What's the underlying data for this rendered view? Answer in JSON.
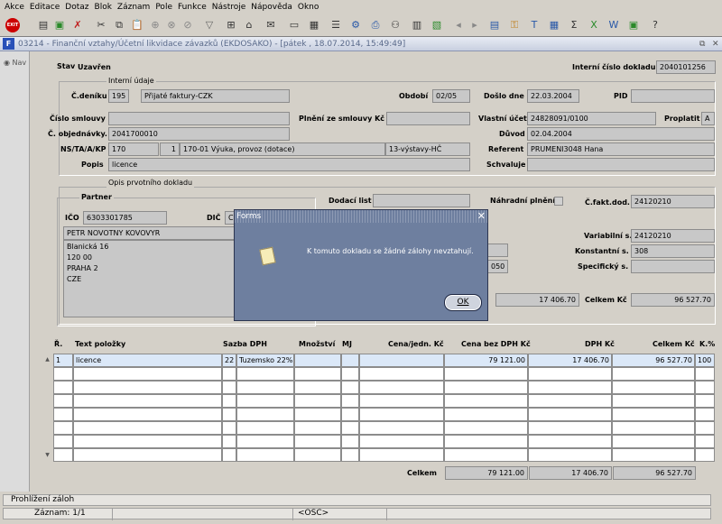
{
  "menu": [
    "Akce",
    "Editace",
    "Dotaz",
    "Blok",
    "Záznam",
    "Pole",
    "Funkce",
    "Nástroje",
    "Nápověda",
    "Okno"
  ],
  "window": {
    "title": "03214 - Finanční vztahy/Účetní likvidace závazků (EKDOSAKO) - [pátek , 18.07.2014, 15:49:49]",
    "nav_label": "Nav"
  },
  "form": {
    "stav_label": "Stav",
    "stav_value": "Uzavřen",
    "icd_label": "Interní číslo dokladu",
    "icd_value": "2040101256",
    "interni_udaje_title": "Interní údaje",
    "cdeniku_label": "Č.deníku",
    "cdeniku_value": "195",
    "cdeniku_text": "Přijaté faktury-CZK",
    "obdobi_label": "Období",
    "obdobi_value": "02/05",
    "doslo_label": "Došlo dne",
    "doslo_value": "22.03.2004",
    "pid_label": "PID",
    "pid_value": "",
    "smlouva_label": "Číslo smlouvy",
    "smlouva_value": "",
    "plneni_label": "Plnění ze smlouvy Kč",
    "plneni_value": "",
    "ucet_label": "Vlastní účet",
    "ucet_value": "24828091/0100",
    "proplatit_label": "Proplatit",
    "proplatit_value": "A",
    "objednavky_label": "Č. objednávky.",
    "objednavky_value": "2041700010",
    "duvod_label": "Důvod",
    "duvod_value": "02.04.2004",
    "ns_label": "NS/TA/A/KP",
    "ns_value": "170",
    "ta_value": "1",
    "a_value": "170-01 Výuka, provoz (dotace)",
    "kp_value": "13-výstavy-HČ",
    "referent_label": "Referent",
    "referent_value": "PRUMENI3048 Hana",
    "popis_label": "Popis",
    "popis_value": "licence",
    "schvaluje_label": "Schvaluje",
    "schvaluje_value": "",
    "opis_title": "Opis prvotního dokladu",
    "partner_title": "Partner",
    "ico_label": "IČO",
    "ico_value": "6303301785",
    "dic_label": "DIČ",
    "dic_value": "C",
    "partner_name": "PETR NOVOTNY KOVOVYR",
    "address": [
      "Blanická  16",
      "120 00",
      "PRAHA 2",
      "CZE"
    ],
    "dodaci_label": "Dodací list",
    "dodaci_value": "",
    "nahradni_label": "Náhradní plnění",
    "cfakt_label": "Č.fakt.dod.",
    "cfakt_value": "24120210",
    "var_label": "Variabilní s.",
    "var_value": "24120210",
    "konst_label": "Konstantní s.",
    "konst_value": "308",
    "spec_label": "Specifický s.",
    "spec_value": "",
    "hidden_val": "050",
    "dph_amount": "17 406.70",
    "celkem_label": "Celkem Kč",
    "celkem_value": "96 527.70"
  },
  "table": {
    "headers": [
      "Ř.",
      "Text položky",
      "Sazba DPH",
      "Množství",
      "MJ",
      "Cena/jedn. Kč",
      "Cena bez DPH Kč",
      "DPH Kč",
      "Celkem Kč",
      "K.%"
    ],
    "row": {
      "r": "1",
      "text": "licence",
      "sazba": "22",
      "typ": "Tuzemsko  22%",
      "mnozstvi": "",
      "mj": "",
      "cena": "",
      "bez_dph": "79 121.00",
      "dph": "17 406.70",
      "celkem": "96 527.70",
      "k": "100"
    },
    "totals_label": "Celkem",
    "total_bez_dph": "79 121.00",
    "total_dph": "17 406.70",
    "total_celkem": "96 527.70"
  },
  "dialog": {
    "title": "Forms",
    "message": "K tomuto dokladu se žádné zálohy nevztahují.",
    "ok_label": "OK"
  },
  "status": {
    "line1": "Prohlížení záloh",
    "line2": "Záznam: 1/1",
    "osc": "<OSC>"
  }
}
